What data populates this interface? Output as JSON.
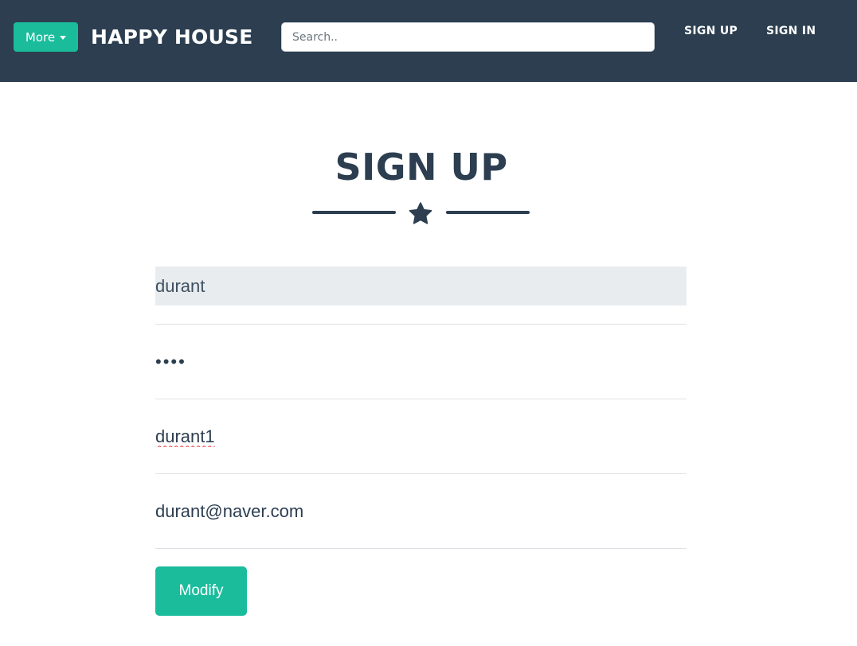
{
  "navbar": {
    "more_label": "More",
    "brand": "HAPPY HOUSE",
    "search_placeholder": "Search..",
    "signup_label": "SIGN UP",
    "signin_label": "SIGN IN"
  },
  "main": {
    "title": "SIGN UP",
    "divider_icon": "star-icon",
    "fields": {
      "user_id": "durant",
      "password": "••••",
      "name": "durant1",
      "email": "durant@naver.com"
    },
    "modify_label": "Modify"
  },
  "colors": {
    "navbar_bg": "#2c3e50",
    "accent": "#1abc9c",
    "disabled_field_bg": "#e9ecef"
  }
}
